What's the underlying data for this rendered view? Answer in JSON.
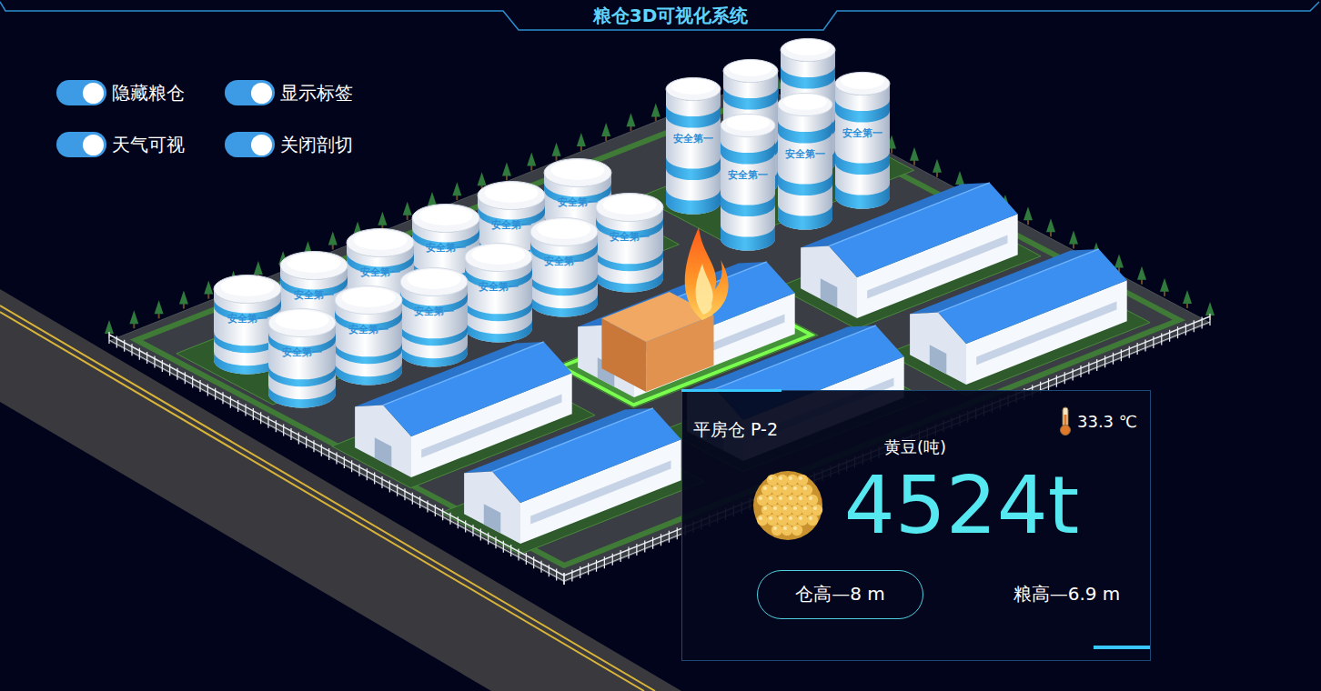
{
  "window": {
    "title": "粮仓3D可视化系统"
  },
  "toggles": [
    {
      "label": "隐藏粮仓",
      "on": true
    },
    {
      "label": "显示标签",
      "on": true
    },
    {
      "label": "天气可视",
      "on": true
    },
    {
      "label": "关闭剖切",
      "on": true
    }
  ],
  "silo_label": "安全第一",
  "warehouses": [
    {
      "selected": false,
      "alarm": false
    },
    {
      "selected": false,
      "alarm": false
    },
    {
      "selected": true,
      "alarm": true
    },
    {
      "selected": false,
      "alarm": false
    },
    {
      "selected": false,
      "alarm": false
    },
    {
      "selected": false,
      "alarm": false
    }
  ],
  "card": {
    "name": "平房仓 P-2",
    "grain": "黄豆(吨)",
    "temperature": "33.3 ℃",
    "amount": "4524t",
    "heights": [
      {
        "label": "仓高—8 m",
        "selected": true
      },
      {
        "label": "粮高—6.9 m",
        "selected": false
      }
    ]
  }
}
